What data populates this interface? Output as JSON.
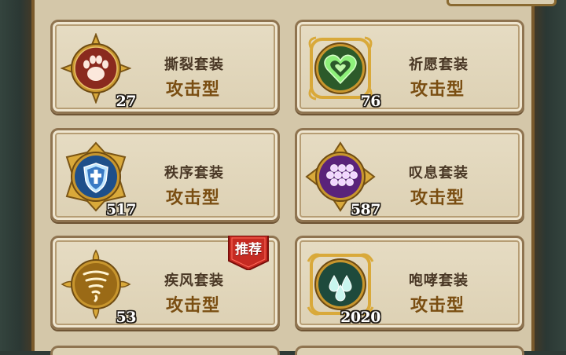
{
  "cards": [
    {
      "name": "撕裂套装",
      "type": "攻击型",
      "count": "27",
      "icon": "paw-icon",
      "color": "#8a2a1e",
      "recommended": false
    },
    {
      "name": "祈愿套装",
      "type": "攻击型",
      "count": "76",
      "icon": "heart-icon",
      "color": "#2c5a2a",
      "recommended": false
    },
    {
      "name": "秩序套装",
      "type": "攻击型",
      "count": "517",
      "icon": "shield-cross-icon",
      "color": "#1e4f8a",
      "recommended": false
    },
    {
      "name": "叹息套装",
      "type": "攻击型",
      "count": "587",
      "icon": "hexagon-cluster-icon",
      "color": "#5a237a",
      "recommended": false
    },
    {
      "name": "疾风套装",
      "type": "攻击型",
      "count": "53",
      "icon": "tornado-icon",
      "color": "#9a6a16",
      "recommended": true,
      "badge": "推荐"
    },
    {
      "name": "咆哮套装",
      "type": "攻击型",
      "count": "2020",
      "icon": "water-drops-icon",
      "color": "#1e4a3c",
      "recommended": false
    }
  ]
}
